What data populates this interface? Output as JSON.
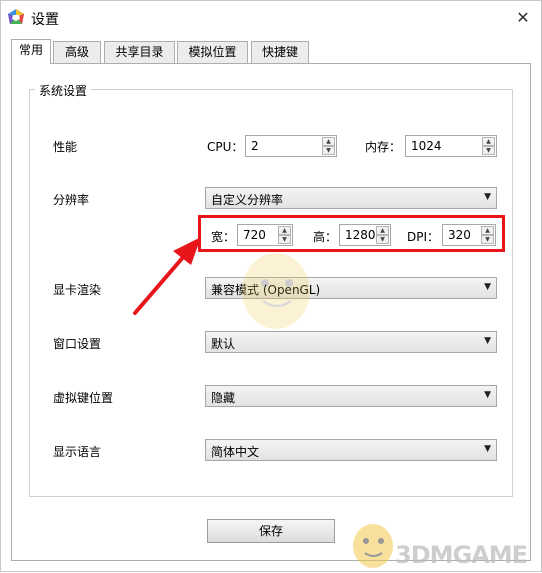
{
  "window": {
    "title": "设置",
    "close_glyph": "✕"
  },
  "tabs": [
    {
      "label": "常用",
      "active": true
    },
    {
      "label": "高级",
      "active": false
    },
    {
      "label": "共享目录",
      "active": false
    },
    {
      "label": "模拟位置",
      "active": false
    },
    {
      "label": "快捷键",
      "active": false
    }
  ],
  "group": {
    "title": "系统设置"
  },
  "performance": {
    "label": "性能",
    "cpu_label": "CPU：",
    "cpu_value": "2",
    "memory_label": "内存：",
    "memory_value": "1024"
  },
  "resolution": {
    "label": "分辨率",
    "selected": "自定义分辨率",
    "width_label": "宽：",
    "width_value": "720",
    "height_label": "高：",
    "height_value": "1280",
    "dpi_label": "DPI：",
    "dpi_value": "320"
  },
  "graphics": {
    "label": "显卡渲染",
    "selected": "兼容模式 (OpenGL)"
  },
  "window_setting": {
    "label": "窗口设置",
    "selected": "默认"
  },
  "virtual_keys": {
    "label": "虚拟键位置",
    "selected": "隐藏"
  },
  "language": {
    "label": "显示语言",
    "selected": "简体中文"
  },
  "save_button": "保存",
  "watermark": "3DMGAME",
  "colors": {
    "annotation_red": "#e8161b"
  }
}
